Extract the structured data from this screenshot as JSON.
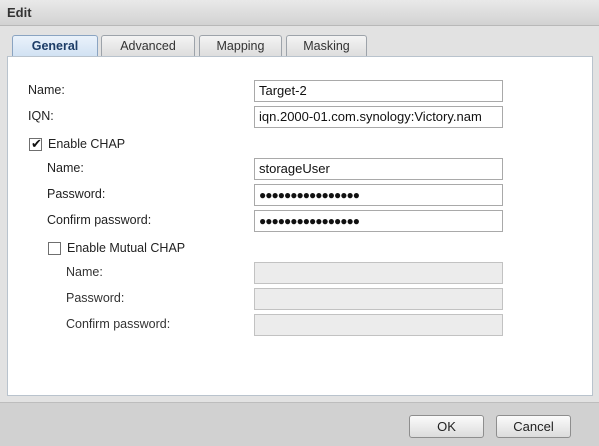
{
  "window": {
    "title": "Edit"
  },
  "tabs": [
    {
      "label": "General",
      "active": true
    },
    {
      "label": "Advanced",
      "active": false
    },
    {
      "label": "Mapping",
      "active": false
    },
    {
      "label": "Masking",
      "active": false
    }
  ],
  "form": {
    "name": {
      "label": "Name:",
      "value": "Target-2"
    },
    "iqn": {
      "label": "IQN:",
      "value": "iqn.2000-01.com.synology:Victory.nam"
    },
    "chap": {
      "label": "Enable CHAP",
      "checked": true,
      "name": {
        "label": "Name:",
        "value": "storageUser"
      },
      "password": {
        "label": "Password:",
        "value": "●●●●●●●●●●●●●●●●"
      },
      "confirm": {
        "label": "Confirm password:",
        "value": "●●●●●●●●●●●●●●●●"
      }
    },
    "mutual_chap": {
      "label": "Enable Mutual CHAP",
      "checked": false,
      "name": {
        "label": "Name:",
        "value": ""
      },
      "password": {
        "label": "Password:",
        "value": ""
      },
      "confirm": {
        "label": "Confirm password:",
        "value": ""
      }
    }
  },
  "footer": {
    "ok_label": "OK",
    "cancel_label": "Cancel"
  }
}
